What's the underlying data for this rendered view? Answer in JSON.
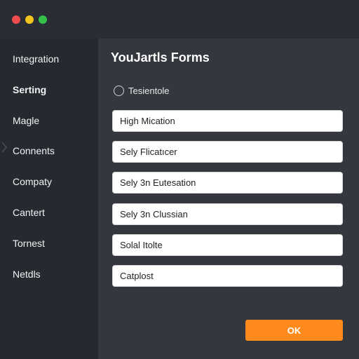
{
  "window": {
    "controls": [
      {
        "name": "close",
        "color": "#ed4c4c"
      },
      {
        "name": "minimize",
        "color": "#f0c31e"
      },
      {
        "name": "maximize",
        "color": "#35c04a"
      }
    ]
  },
  "sidebar": {
    "items": [
      {
        "label": "Integration"
      },
      {
        "label": "Serting",
        "active": true
      },
      {
        "label": "Magle"
      },
      {
        "label": "Connents"
      },
      {
        "label": "Compaty"
      },
      {
        "label": "Cantert"
      },
      {
        "label": "Tornest"
      },
      {
        "label": "Netdls"
      }
    ]
  },
  "main": {
    "title": "YouJartls Forms",
    "radio": {
      "label": "Tesientole",
      "checked": false
    },
    "fields": [
      {
        "value": "High Mication"
      },
      {
        "value": "Sely Flicatıcer"
      },
      {
        "value": "Sely 3n Eutesation"
      },
      {
        "value": "Sely 3n Clussian"
      },
      {
        "value": "Solal Itolte"
      },
      {
        "value": "Catplost"
      }
    ],
    "ok_label": "OK"
  },
  "colors": {
    "accent": "#ff8a1c",
    "sidebar_bg": "#262930",
    "main_bg": "#34373e"
  }
}
